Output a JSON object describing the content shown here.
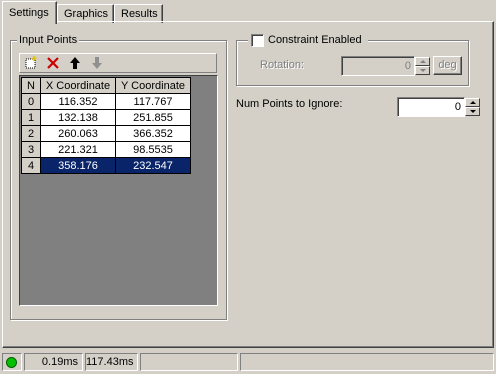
{
  "tabs": [
    {
      "label": "Settings",
      "active": true
    },
    {
      "label": "Graphics",
      "active": false
    },
    {
      "label": "Results",
      "active": false
    }
  ],
  "input_points": {
    "title": "Input Points",
    "toolbar": {
      "new": "new-item-icon",
      "delete": "delete-x-icon",
      "move_up": "arrow-up-icon",
      "move_down": "arrow-down-icon"
    },
    "columns": [
      "N",
      "X Coordinate",
      "Y Coordinate"
    ],
    "rows": [
      {
        "n": "0",
        "x": "116.352",
        "y": "117.767",
        "selected": false
      },
      {
        "n": "1",
        "x": "132.138",
        "y": "251.855",
        "selected": false
      },
      {
        "n": "2",
        "x": "260.063",
        "y": "366.352",
        "selected": false
      },
      {
        "n": "3",
        "x": "221.321",
        "y": "98.5535",
        "selected": false
      },
      {
        "n": "4",
        "x": "358.176",
        "y": "232.547",
        "selected": true
      }
    ]
  },
  "constraint": {
    "label": "Constraint Enabled",
    "checked": false,
    "rotation_label": "Rotation:",
    "rotation_value": "0",
    "unit_button": "deg"
  },
  "num_points": {
    "label": "Num Points to Ignore:",
    "value": "0"
  },
  "status": {
    "indicator_color": "#00c000",
    "time1": "0.19ms",
    "time2": "117.43ms"
  },
  "colors": {
    "face": "#d4d0c8",
    "selection": "#0a246a",
    "delete_red": "#cc0000"
  }
}
